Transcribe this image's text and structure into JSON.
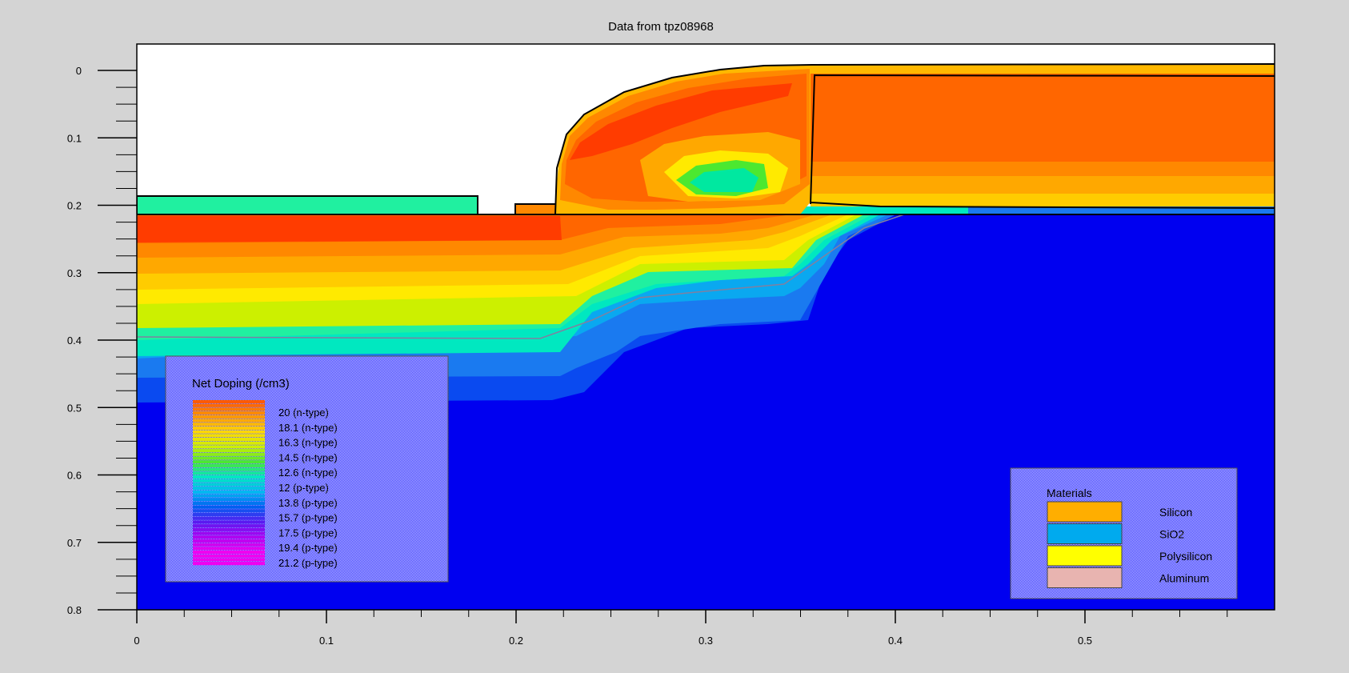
{
  "chart_data": {
    "type": "heatmap",
    "title": "Data from tpz08968",
    "xlabel": "",
    "ylabel": "",
    "xlim": [
      0,
      0.6
    ],
    "ylim": [
      0,
      0.8
    ],
    "y_inverted": true,
    "x_ticks": [
      0,
      0.1,
      0.2,
      0.3,
      0.4,
      0.5
    ],
    "x_tick_labels": [
      "0",
      "0.1",
      "0.2",
      "0.3",
      "0.4",
      "0.5"
    ],
    "y_ticks": [
      0,
      0.1,
      0.2,
      0.3,
      0.4,
      0.5,
      0.6,
      0.7,
      0.8
    ],
    "y_tick_labels": [
      "0",
      "0.1",
      "0.2",
      "0.3",
      "0.4",
      "0.5",
      "0.6",
      "0.7",
      "0.8"
    ],
    "grid": false,
    "doping_legend": {
      "title": "Net Doping (/cm3)",
      "placement": "bottom-left",
      "entries": [
        {
          "label": "20 (n-type)",
          "color": "#ff5a00"
        },
        {
          "label": "18.1 (n-type)",
          "color": "#ff9a00"
        },
        {
          "label": "16.3 (n-type)",
          "color": "#ffd800"
        },
        {
          "label": "14.5 (n-type)",
          "color": "#ccf000"
        },
        {
          "label": "12.6 (n-type)",
          "color": "#4ce830"
        },
        {
          "label": "12 (p-type)",
          "color": "#00e8c0"
        },
        {
          "label": "13.8 (p-type)",
          "color": "#00b8f0"
        },
        {
          "label": "15.7 (p-type)",
          "color": "#0060f0"
        },
        {
          "label": "17.5 (p-type)",
          "color": "#5a1af0"
        },
        {
          "label": "19.4 (p-type)",
          "color": "#b000f0"
        },
        {
          "label": "21.2 (p-type)",
          "color": "#f000f0"
        }
      ]
    },
    "materials_legend": {
      "title": "Materials",
      "placement": "bottom-right",
      "entries": [
        {
          "label": "Silicon",
          "color": "#ffae00"
        },
        {
          "label": "SiO2",
          "color": "#00aaee"
        },
        {
          "label": "Polysilicon",
          "color": "#ffff00"
        },
        {
          "label": "Aluminum",
          "color": "#e8b4b0"
        }
      ]
    },
    "colors": {
      "background": "#d4d4d4",
      "substrate": "#0000f0",
      "outline": "#000000"
    }
  }
}
